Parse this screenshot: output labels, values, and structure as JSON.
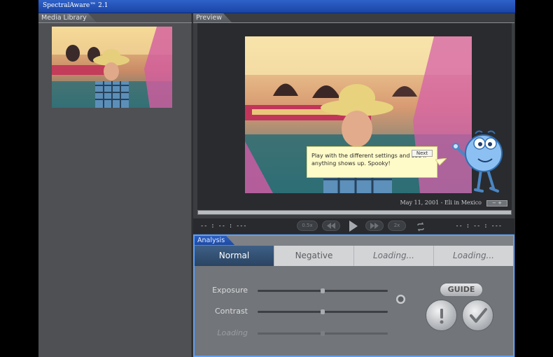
{
  "app": {
    "title": "SpectralAware™ 2.1"
  },
  "library": {
    "label": "Media Library"
  },
  "preview": {
    "label": "Preview",
    "caption": "May 11, 2001 - Eli in Mexico",
    "zoom_minus": "−",
    "zoom_value": "+",
    "tooltip": {
      "message": "Play with the different settings and see if anything shows up. Spooky!",
      "next_label": "Next"
    },
    "progress_fraction": 1.0
  },
  "transport": {
    "time_left": "-- : -- : ---",
    "time_right": "-- : -- : ---",
    "slow_label": "0.5x",
    "fast_label": "2x"
  },
  "analysis": {
    "label": "Analysis",
    "tabs": [
      {
        "label": "Normal"
      },
      {
        "label": "Negative"
      },
      {
        "label": "Loading..."
      },
      {
        "label": "Loading..."
      }
    ],
    "sliders": [
      {
        "label": "Exposure",
        "value": 0.5
      },
      {
        "label": "Contrast",
        "value": 0.5
      },
      {
        "label": "Loading",
        "value": 0.5
      }
    ],
    "guide_label": "GUIDE"
  },
  "colors": {
    "titlebar": "#2454b8",
    "analysis_border": "#5aa0ff",
    "active_tab": "#2f4b6e",
    "tooltip_bg": "#fffbc9"
  },
  "icons": [
    "mascot-character-icon",
    "rewind-icon",
    "play-icon",
    "forward-icon",
    "loop-icon",
    "warning-exclamation-icon",
    "checkmark-icon"
  ]
}
